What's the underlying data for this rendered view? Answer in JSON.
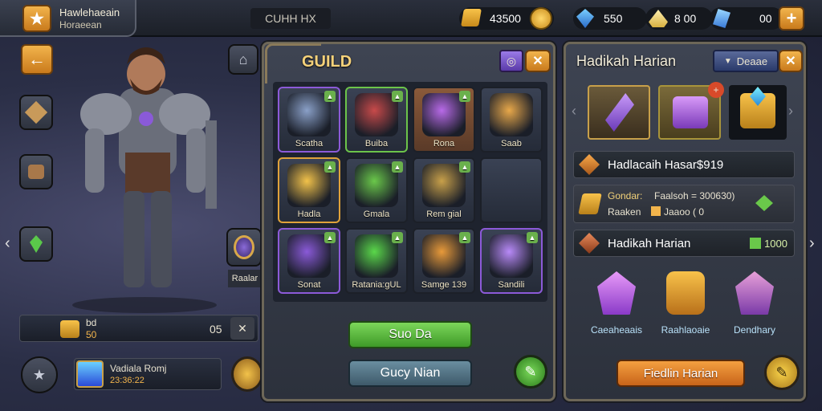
{
  "hero": {
    "name": "Hawlehaeain",
    "subtitle": "Horaeean"
  },
  "header": {
    "title": "CUHH HX"
  },
  "resources": [
    {
      "icon": "gold-bar-icon",
      "value": "43500"
    },
    {
      "icon": "blue-gem-icon",
      "value": "550"
    },
    {
      "icon": "crystal-icon",
      "value": "8 00"
    },
    {
      "icon": "blue-shard-icon",
      "value": "00"
    }
  ],
  "left": {
    "side_label": "Raalar",
    "stat_label": "bd",
    "stat_value": "50",
    "stat_right": "05",
    "bottom_name": "Vadiala Romj",
    "bottom_value": "23:36:22"
  },
  "guild": {
    "title": "GUILD",
    "items": [
      {
        "label": "Scatha",
        "style": "purple",
        "icon": "knight-portrait-icon"
      },
      {
        "label": "Buiba",
        "style": "green",
        "icon": "warrior-portrait-icon"
      },
      {
        "label": "Rona",
        "style": "orange",
        "icon": "purple-chest-icon"
      },
      {
        "label": "Saab",
        "style": "",
        "icon": "crystal-staff-icon"
      },
      {
        "label": "Hadla",
        "style": "gold",
        "icon": "blue-shield-icon"
      },
      {
        "label": "Gmala",
        "style": "",
        "icon": "emerald-medal-icon"
      },
      {
        "label": "Rem gial",
        "style": "",
        "icon": "gold-amulet-icon"
      },
      {
        "label": "",
        "style": "",
        "icon": "empty-slot"
      },
      {
        "label": "Sonat",
        "style": "purple",
        "icon": "purple-orb-icon"
      },
      {
        "label": "Ratania:gUL",
        "style": "",
        "icon": "green-gem-icon"
      },
      {
        "label": "Samge 139",
        "style": "",
        "icon": "orange-crystal-icon"
      },
      {
        "label": "Sandili",
        "style": "purple",
        "icon": "purple-crown-icon"
      }
    ],
    "primary_button": "Suo Da",
    "secondary_button": "Gucy Nian"
  },
  "daily": {
    "title": "Hadikah Harian",
    "tab": "Deaae",
    "row1": "Hadlacaih Hasar$919",
    "row2_a": "Gondar:",
    "row2_b": "Faalsoh = 300630)",
    "row2_c": "Raaken",
    "row2_d": "Jaaoo ( 0",
    "row3": "Hadikah Harian",
    "row3_value": "1000",
    "rewards": [
      {
        "label": "Caeaheaais",
        "icon": "purple-potion-icon"
      },
      {
        "label": "Raahlaoaie",
        "icon": "gold-chest-icon"
      },
      {
        "label": "Dendhary",
        "icon": "staff-bundle-icon"
      }
    ],
    "button": "Fiedlin Harian"
  }
}
